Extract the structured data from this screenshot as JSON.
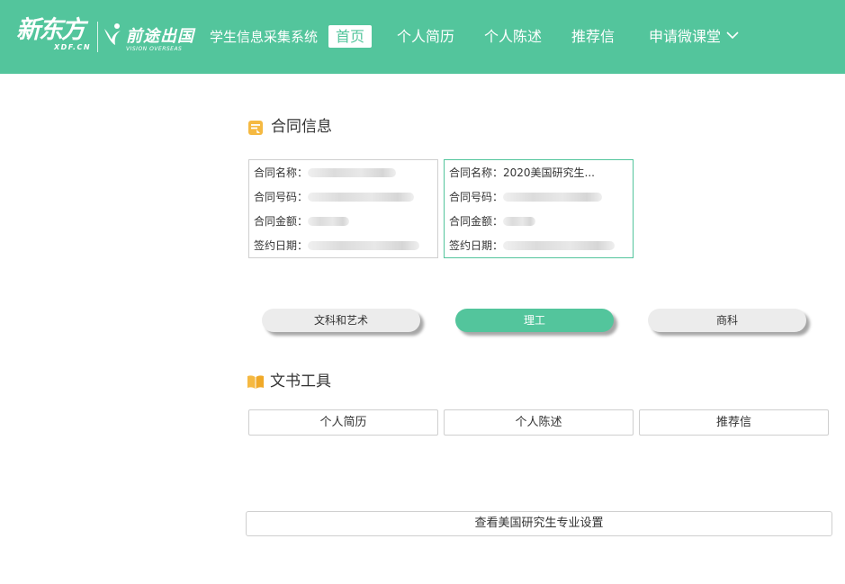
{
  "header": {
    "logo_primary": "新东方",
    "logo_primary_en": "XDF.CN",
    "logo_secondary": "前途出国",
    "logo_secondary_en": "VISION OVERSEAS",
    "system_title": "学生信息采集系统",
    "nav": {
      "home": "首页",
      "resume": "个人简历",
      "statement": "个人陈述",
      "recommendation": "推荐信",
      "microclass": "申请微课堂"
    },
    "colors": {
      "brand": "#53c59c",
      "text_on_brand": "#ffffff"
    }
  },
  "contract_section": {
    "title": "合同信息",
    "icon": "document-icon",
    "cards": [
      {
        "name_label": "合同名称：",
        "name_value": "",
        "number_label": "合同号码：",
        "number_value": "",
        "amount_label": "合同金额：",
        "amount_value": "",
        "date_label": "签约日期：",
        "date_value": "",
        "selected": false
      },
      {
        "name_label": "合同名称：",
        "name_value": "2020美国研究生...",
        "number_label": "合同号码：",
        "number_value": "",
        "amount_label": "合同金额：",
        "amount_value": "",
        "date_label": "签约日期：",
        "date_value": "",
        "selected": true
      }
    ]
  },
  "categories": {
    "items": [
      "文科和艺术",
      "理工",
      "商科"
    ],
    "selected": "理工"
  },
  "tools_section": {
    "title": "文书工具",
    "icon": "book-icon",
    "buttons": [
      "个人简历",
      "个人陈述",
      "推荐信"
    ]
  },
  "settings_button": "查看美国研究生专业设置"
}
